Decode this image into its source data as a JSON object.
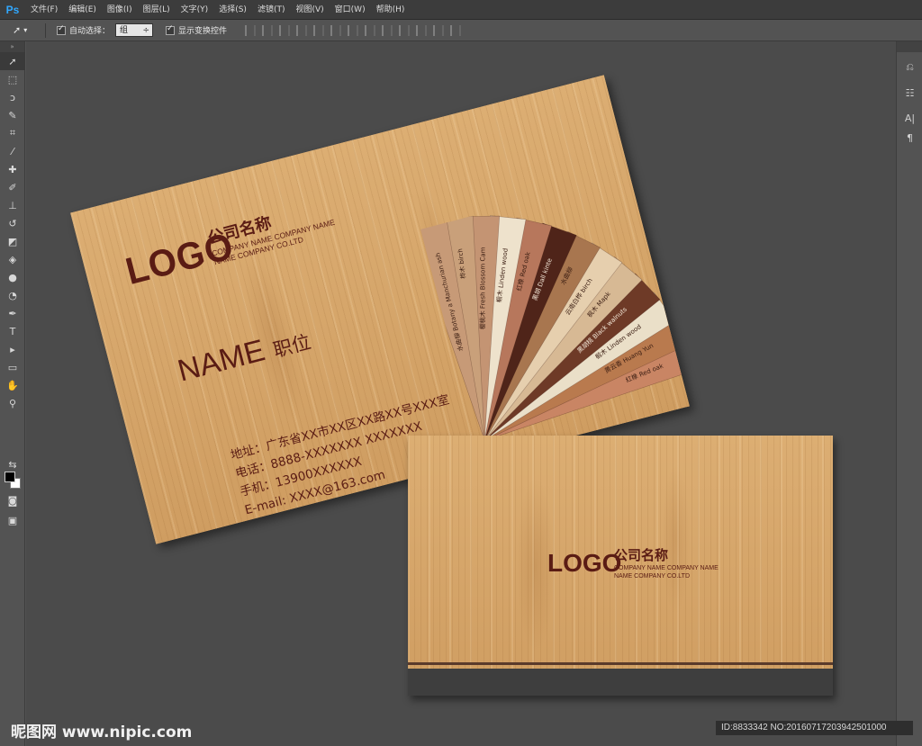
{
  "app": {
    "logo": "Ps"
  },
  "menu": [
    "文件(F)",
    "编辑(E)",
    "图像(I)",
    "图层(L)",
    "文字(Y)",
    "选择(S)",
    "滤镜(T)",
    "视图(V)",
    "窗口(W)",
    "帮助(H)"
  ],
  "options": {
    "auto_select_label": "自动选择：",
    "auto_select_value": "组",
    "show_transform_label": "显示变换控件"
  },
  "card_front": {
    "logo": "LOGO",
    "company_cn": "公司名称",
    "company_en_1": "COMPANY NAME COMPANY NAME",
    "company_en_2": "NAME COMPANY CO.LTD",
    "name": "NAME",
    "position": "职位",
    "address": "地址：广东省XX市XX区XX路XX号XXX室",
    "phone": "电话：8888-XXXXXXX    XXXXXXX",
    "mobile": "手机：13900XXXXXX",
    "email": "E-mail: XXXX@163.com",
    "swatches": [
      {
        "label": "红橡 Red oak",
        "color": "#c98564"
      },
      {
        "label": "黄云香 Huang Yun",
        "color": "#b97a4e"
      },
      {
        "label": "椴木 Linden wood",
        "color": "#eadfc8"
      },
      {
        "label": "黑胡桃 Black walnuts",
        "color": "#6e3a27"
      },
      {
        "label": "枫木 Mapk",
        "color": "#d7b994"
      },
      {
        "label": "云南白桦 birch",
        "color": "#e6cfae"
      },
      {
        "label": "水曲柳",
        "color": "#a8764f"
      },
      {
        "label": "黑胡 Dall kinte",
        "color": "#4f2419"
      },
      {
        "label": "红橡 Red oak",
        "color": "#b7775c"
      },
      {
        "label": "椴木 Linden wood",
        "color": "#eee2cc"
      },
      {
        "label": "樱桃木 Fresh Blossom Cam",
        "color": "#c49473"
      },
      {
        "label": "桦木 birch",
        "color": "#c9a07a"
      },
      {
        "label": "水曲柳 Botany a Manchurian ash",
        "color": "#c79a77"
      }
    ]
  },
  "card_back": {
    "logo": "LOGO",
    "company_cn": "公司名称",
    "company_en_1": "COMPANY NAME COMPANY NAME",
    "company_en_2": "NAME COMPANY CO.LTD"
  },
  "watermark": {
    "site": "昵图网 www.nipic.com",
    "id": "ID:8833342 NO:20160717203942501000"
  }
}
